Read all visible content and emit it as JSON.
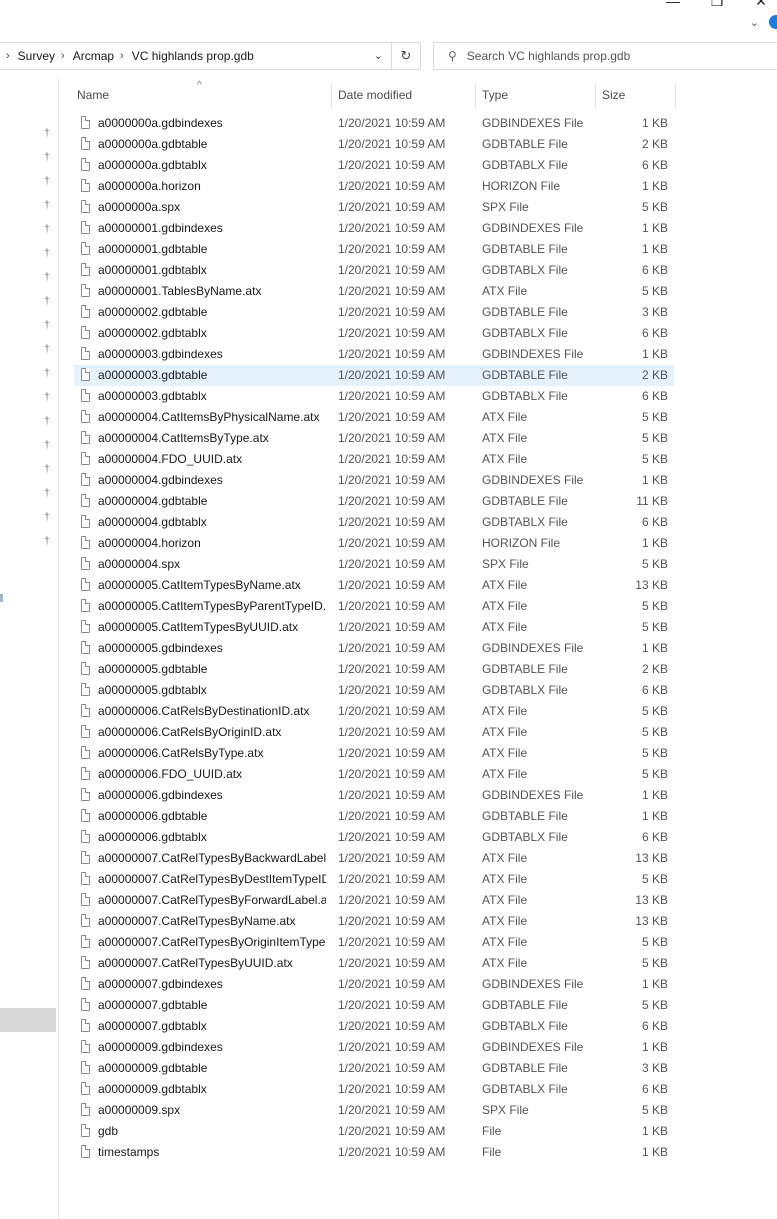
{
  "address": {
    "crumbs": [
      "Survey",
      "Arcmap",
      "VC highlands prop.gdb"
    ]
  },
  "search": {
    "placeholder": "Search VC highlands prop.gdb"
  },
  "columns": {
    "name": "Name",
    "date": "Date modified",
    "type": "Type",
    "size": "Size"
  },
  "selected_row": 12,
  "files": [
    {
      "name": "a0000000a.gdbindexes",
      "date": "1/20/2021 10:59 AM",
      "type": "GDBINDEXES File",
      "size": "1 KB"
    },
    {
      "name": "a0000000a.gdbtable",
      "date": "1/20/2021 10:59 AM",
      "type": "GDBTABLE File",
      "size": "2 KB"
    },
    {
      "name": "a0000000a.gdbtablx",
      "date": "1/20/2021 10:59 AM",
      "type": "GDBTABLX File",
      "size": "6 KB"
    },
    {
      "name": "a0000000a.horizon",
      "date": "1/20/2021 10:59 AM",
      "type": "HORIZON File",
      "size": "1 KB"
    },
    {
      "name": "a0000000a.spx",
      "date": "1/20/2021 10:59 AM",
      "type": "SPX File",
      "size": "5 KB"
    },
    {
      "name": "a00000001.gdbindexes",
      "date": "1/20/2021 10:59 AM",
      "type": "GDBINDEXES File",
      "size": "1 KB"
    },
    {
      "name": "a00000001.gdbtable",
      "date": "1/20/2021 10:59 AM",
      "type": "GDBTABLE File",
      "size": "1 KB"
    },
    {
      "name": "a00000001.gdbtablx",
      "date": "1/20/2021 10:59 AM",
      "type": "GDBTABLX File",
      "size": "6 KB"
    },
    {
      "name": "a00000001.TablesByName.atx",
      "date": "1/20/2021 10:59 AM",
      "type": "ATX File",
      "size": "5 KB"
    },
    {
      "name": "a00000002.gdbtable",
      "date": "1/20/2021 10:59 AM",
      "type": "GDBTABLE File",
      "size": "3 KB"
    },
    {
      "name": "a00000002.gdbtablx",
      "date": "1/20/2021 10:59 AM",
      "type": "GDBTABLX File",
      "size": "6 KB"
    },
    {
      "name": "a00000003.gdbindexes",
      "date": "1/20/2021 10:59 AM",
      "type": "GDBINDEXES File",
      "size": "1 KB"
    },
    {
      "name": "a00000003.gdbtable",
      "date": "1/20/2021 10:59 AM",
      "type": "GDBTABLE File",
      "size": "2 KB"
    },
    {
      "name": "a00000003.gdbtablx",
      "date": "1/20/2021 10:59 AM",
      "type": "GDBTABLX File",
      "size": "6 KB"
    },
    {
      "name": "a00000004.CatItemsByPhysicalName.atx",
      "date": "1/20/2021 10:59 AM",
      "type": "ATX File",
      "size": "5 KB"
    },
    {
      "name": "a00000004.CatItemsByType.atx",
      "date": "1/20/2021 10:59 AM",
      "type": "ATX File",
      "size": "5 KB"
    },
    {
      "name": "a00000004.FDO_UUID.atx",
      "date": "1/20/2021 10:59 AM",
      "type": "ATX File",
      "size": "5 KB"
    },
    {
      "name": "a00000004.gdbindexes",
      "date": "1/20/2021 10:59 AM",
      "type": "GDBINDEXES File",
      "size": "1 KB"
    },
    {
      "name": "a00000004.gdbtable",
      "date": "1/20/2021 10:59 AM",
      "type": "GDBTABLE File",
      "size": "11 KB"
    },
    {
      "name": "a00000004.gdbtablx",
      "date": "1/20/2021 10:59 AM",
      "type": "GDBTABLX File",
      "size": "6 KB"
    },
    {
      "name": "a00000004.horizon",
      "date": "1/20/2021 10:59 AM",
      "type": "HORIZON File",
      "size": "1 KB"
    },
    {
      "name": "a00000004.spx",
      "date": "1/20/2021 10:59 AM",
      "type": "SPX File",
      "size": "5 KB"
    },
    {
      "name": "a00000005.CatItemTypesByName.atx",
      "date": "1/20/2021 10:59 AM",
      "type": "ATX File",
      "size": "13 KB"
    },
    {
      "name": "a00000005.CatItemTypesByParentTypeID....",
      "date": "1/20/2021 10:59 AM",
      "type": "ATX File",
      "size": "5 KB"
    },
    {
      "name": "a00000005.CatItemTypesByUUID.atx",
      "date": "1/20/2021 10:59 AM",
      "type": "ATX File",
      "size": "5 KB"
    },
    {
      "name": "a00000005.gdbindexes",
      "date": "1/20/2021 10:59 AM",
      "type": "GDBINDEXES File",
      "size": "1 KB"
    },
    {
      "name": "a00000005.gdbtable",
      "date": "1/20/2021 10:59 AM",
      "type": "GDBTABLE File",
      "size": "2 KB"
    },
    {
      "name": "a00000005.gdbtablx",
      "date": "1/20/2021 10:59 AM",
      "type": "GDBTABLX File",
      "size": "6 KB"
    },
    {
      "name": "a00000006.CatRelsByDestinationID.atx",
      "date": "1/20/2021 10:59 AM",
      "type": "ATX File",
      "size": "5 KB"
    },
    {
      "name": "a00000006.CatRelsByOriginID.atx",
      "date": "1/20/2021 10:59 AM",
      "type": "ATX File",
      "size": "5 KB"
    },
    {
      "name": "a00000006.CatRelsByType.atx",
      "date": "1/20/2021 10:59 AM",
      "type": "ATX File",
      "size": "5 KB"
    },
    {
      "name": "a00000006.FDO_UUID.atx",
      "date": "1/20/2021 10:59 AM",
      "type": "ATX File",
      "size": "5 KB"
    },
    {
      "name": "a00000006.gdbindexes",
      "date": "1/20/2021 10:59 AM",
      "type": "GDBINDEXES File",
      "size": "1 KB"
    },
    {
      "name": "a00000006.gdbtable",
      "date": "1/20/2021 10:59 AM",
      "type": "GDBTABLE File",
      "size": "1 KB"
    },
    {
      "name": "a00000006.gdbtablx",
      "date": "1/20/2021 10:59 AM",
      "type": "GDBTABLX File",
      "size": "6 KB"
    },
    {
      "name": "a00000007.CatRelTypesByBackwardLabel....",
      "date": "1/20/2021 10:59 AM",
      "type": "ATX File",
      "size": "13 KB"
    },
    {
      "name": "a00000007.CatRelTypesByDestItemTypeID...",
      "date": "1/20/2021 10:59 AM",
      "type": "ATX File",
      "size": "5 KB"
    },
    {
      "name": "a00000007.CatRelTypesByForwardLabel.atx",
      "date": "1/20/2021 10:59 AM",
      "type": "ATX File",
      "size": "13 KB"
    },
    {
      "name": "a00000007.CatRelTypesByName.atx",
      "date": "1/20/2021 10:59 AM",
      "type": "ATX File",
      "size": "13 KB"
    },
    {
      "name": "a00000007.CatRelTypesByOriginItemTypel...",
      "date": "1/20/2021 10:59 AM",
      "type": "ATX File",
      "size": "5 KB"
    },
    {
      "name": "a00000007.CatRelTypesByUUID.atx",
      "date": "1/20/2021 10:59 AM",
      "type": "ATX File",
      "size": "5 KB"
    },
    {
      "name": "a00000007.gdbindexes",
      "date": "1/20/2021 10:59 AM",
      "type": "GDBINDEXES File",
      "size": "1 KB"
    },
    {
      "name": "a00000007.gdbtable",
      "date": "1/20/2021 10:59 AM",
      "type": "GDBTABLE File",
      "size": "5 KB"
    },
    {
      "name": "a00000007.gdbtablx",
      "date": "1/20/2021 10:59 AM",
      "type": "GDBTABLX File",
      "size": "6 KB"
    },
    {
      "name": "a00000009.gdbindexes",
      "date": "1/20/2021 10:59 AM",
      "type": "GDBINDEXES File",
      "size": "1 KB"
    },
    {
      "name": "a00000009.gdbtable",
      "date": "1/20/2021 10:59 AM",
      "type": "GDBTABLE File",
      "size": "3 KB"
    },
    {
      "name": "a00000009.gdbtablx",
      "date": "1/20/2021 10:59 AM",
      "type": "GDBTABLX File",
      "size": "6 KB"
    },
    {
      "name": "a00000009.spx",
      "date": "1/20/2021 10:59 AM",
      "type": "SPX File",
      "size": "5 KB"
    },
    {
      "name": "gdb",
      "date": "1/20/2021 10:59 AM",
      "type": "File",
      "size": "1 KB"
    },
    {
      "name": "timestamps",
      "date": "1/20/2021 10:59 AM",
      "type": "File",
      "size": "1 KB"
    }
  ]
}
